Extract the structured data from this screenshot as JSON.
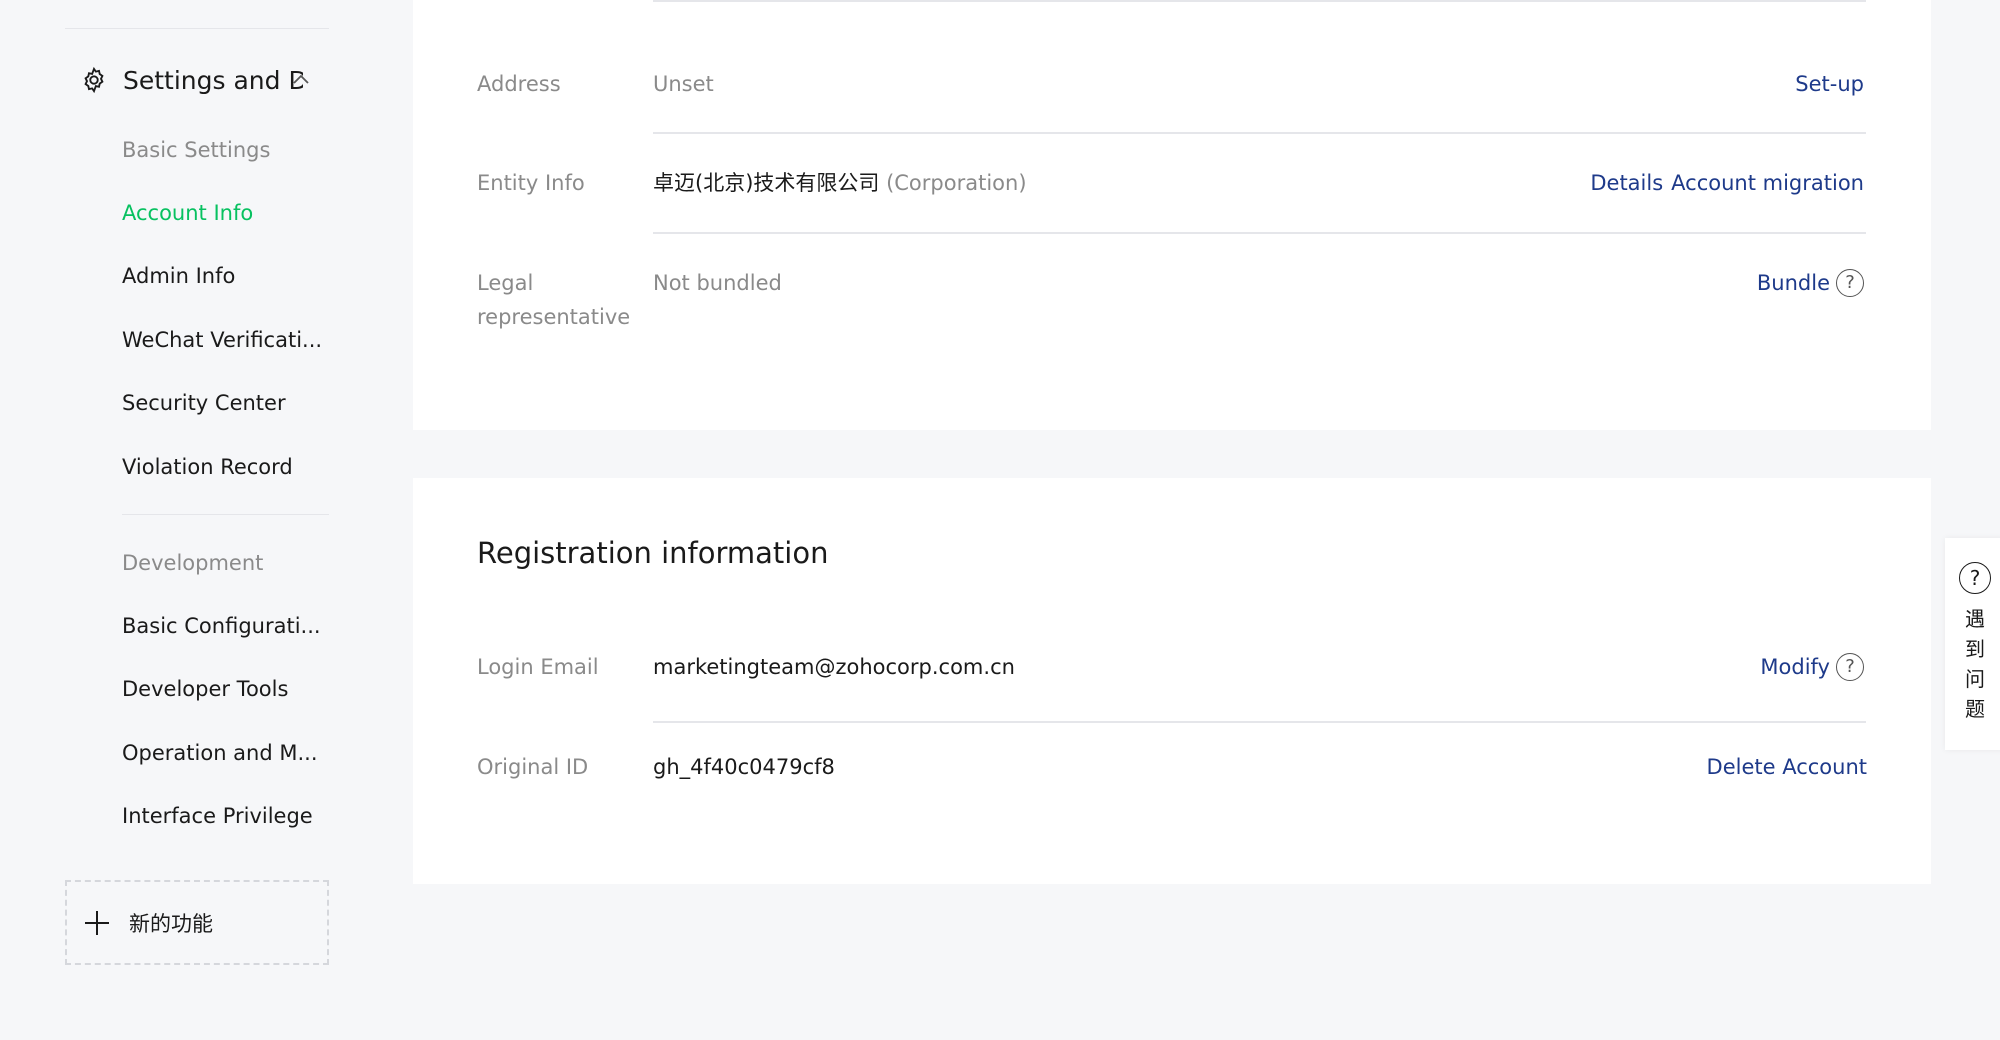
{
  "sidebar": {
    "section_title": "Settings and D",
    "groups": {
      "basic": "Basic Settings",
      "development": "Development"
    },
    "items": [
      {
        "label": "Account Info"
      },
      {
        "label": "Admin Info"
      },
      {
        "label": "WeChat Verificati..."
      },
      {
        "label": "Security Center"
      },
      {
        "label": "Violation Record"
      },
      {
        "label": "Basic Configurati..."
      },
      {
        "label": "Developer Tools"
      },
      {
        "label": "Operation and M..."
      },
      {
        "label": "Interface Privilege"
      }
    ],
    "active_item": "Account Info",
    "new_feature": "新的功能"
  },
  "account_card": {
    "rows": [
      {
        "label": "Address",
        "value": "Unset",
        "action": "Set-up"
      },
      {
        "label": "Entity Info",
        "value": "卓迈(北京)技术有限公司",
        "value_suffix": "(Corporation)",
        "actions": [
          "Details",
          "Account migration"
        ]
      },
      {
        "label_line1": "Legal",
        "label_line2": "representative",
        "value": "Not bundled",
        "action": "Bundle",
        "help_icon": "?"
      }
    ]
  },
  "registration_card": {
    "title": "Registration information",
    "rows": [
      {
        "label": "Login Email",
        "value": "marketingteam@zohocorp.com.cn",
        "action": "Modify",
        "help_icon": "?"
      },
      {
        "label": "Original ID",
        "value": "gh_4f40c0479cf8",
        "action": "Delete Account"
      }
    ]
  },
  "help_float": {
    "icon": "?",
    "label": "遇到问题"
  },
  "colors": {
    "accent_green": "#07c160",
    "link_blue": "#1e3a8a",
    "background": "#f6f7f9"
  }
}
